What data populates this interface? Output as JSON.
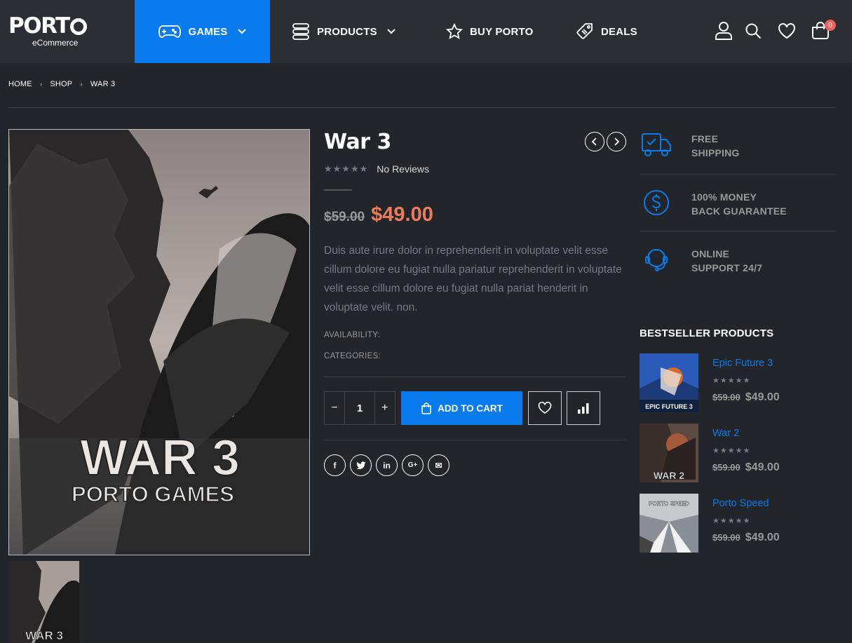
{
  "header": {
    "logo_text": "PORT",
    "logo_sub": "eCommerce",
    "nav": [
      {
        "label": "GAMES"
      },
      {
        "label": "PRODUCTS"
      },
      {
        "label": "BUY PORTO"
      },
      {
        "label": "DEALS"
      }
    ],
    "cart_count": "0"
  },
  "breadcrumb": [
    "HOME",
    "SHOP",
    "WAR 3"
  ],
  "product": {
    "title": "War 3",
    "reviews": "No Reviews",
    "stars": "★★★★★",
    "old_price": "$59.00",
    "price": "$49.00",
    "description": "Duis aute irure dolor in reprehenderit in voluptate velit esse cillum dolore eu fugiat nulla pariatur reprehenderit in voluptate velit esse cillum dolore eu fugiat nulla pariat henderit in voluptate velit. non.",
    "availability_label": "AVAILABILITY:",
    "categories_label": "CATEGORIES:",
    "quantity": "1",
    "qty_minus": "−",
    "qty_plus": "+",
    "add_to_cart": "ADD TO CART",
    "cover_title": "WAR 3",
    "cover_sub": "PORTO GAMES",
    "share": [
      "f",
      "t",
      "in",
      "G+",
      "✉"
    ]
  },
  "features": [
    {
      "line1": "FREE",
      "line2": "SHIPPING",
      "icon": "truck-icon"
    },
    {
      "line1": "100% MONEY",
      "line2": "BACK GUARANTEE",
      "icon": "dollar-circle-icon"
    },
    {
      "line1": "ONLINE",
      "line2": "SUPPORT 24/7",
      "icon": "headset-icon"
    }
  ],
  "bestsellers": {
    "title": "BESTSELLER PRODUCTS",
    "items": [
      {
        "name": "Epic Future 3",
        "old_price": "$59.00",
        "price": "$49.00",
        "stars": "★★★★★",
        "cover": "EPIC FUTURE 3"
      },
      {
        "name": "War 2",
        "old_price": "$59.00",
        "price": "$49.00",
        "stars": "★★★★★",
        "cover": "WAR 2"
      },
      {
        "name": "Porto Speed",
        "old_price": "$59.00",
        "price": "$49.00",
        "stars": "★★★★★",
        "cover": "PORTO SPEED"
      }
    ]
  },
  "colors": {
    "accent": "#0a7bec",
    "sale_price": "#ec7b5c",
    "background": "#222529",
    "header": "#2b2e33",
    "badge": "#e8635b"
  }
}
